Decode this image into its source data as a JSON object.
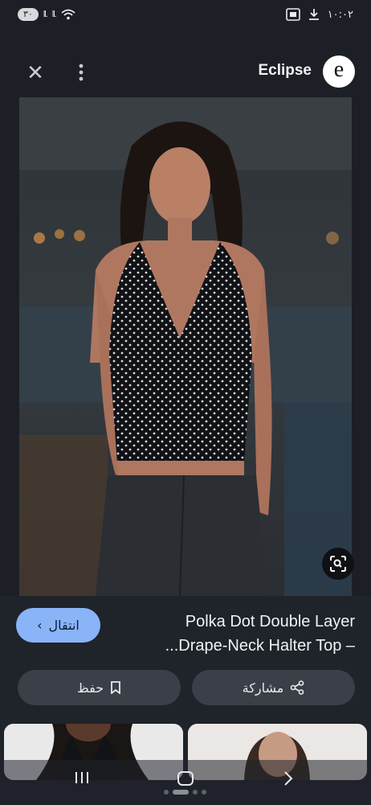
{
  "status_bar": {
    "battery": "٣٠",
    "signal_1": "ll.",
    "signal_2": "ll.",
    "time": "١٠:٠٢"
  },
  "header": {
    "close_icon": "close-icon",
    "more_icon": "more-vert-icon",
    "brand": "Eclipse",
    "logo_letter": "e"
  },
  "result": {
    "title_line1": "Polka Dot Double Layer",
    "title_line2": "...Drape-Neck Halter Top –",
    "visit_label": "انتقال",
    "save_label": "حفظ",
    "share_label": "مشاركة"
  },
  "colors": {
    "background": "#1c1f25",
    "accent": "#8ab4f8",
    "pill": "#3a3f48"
  }
}
